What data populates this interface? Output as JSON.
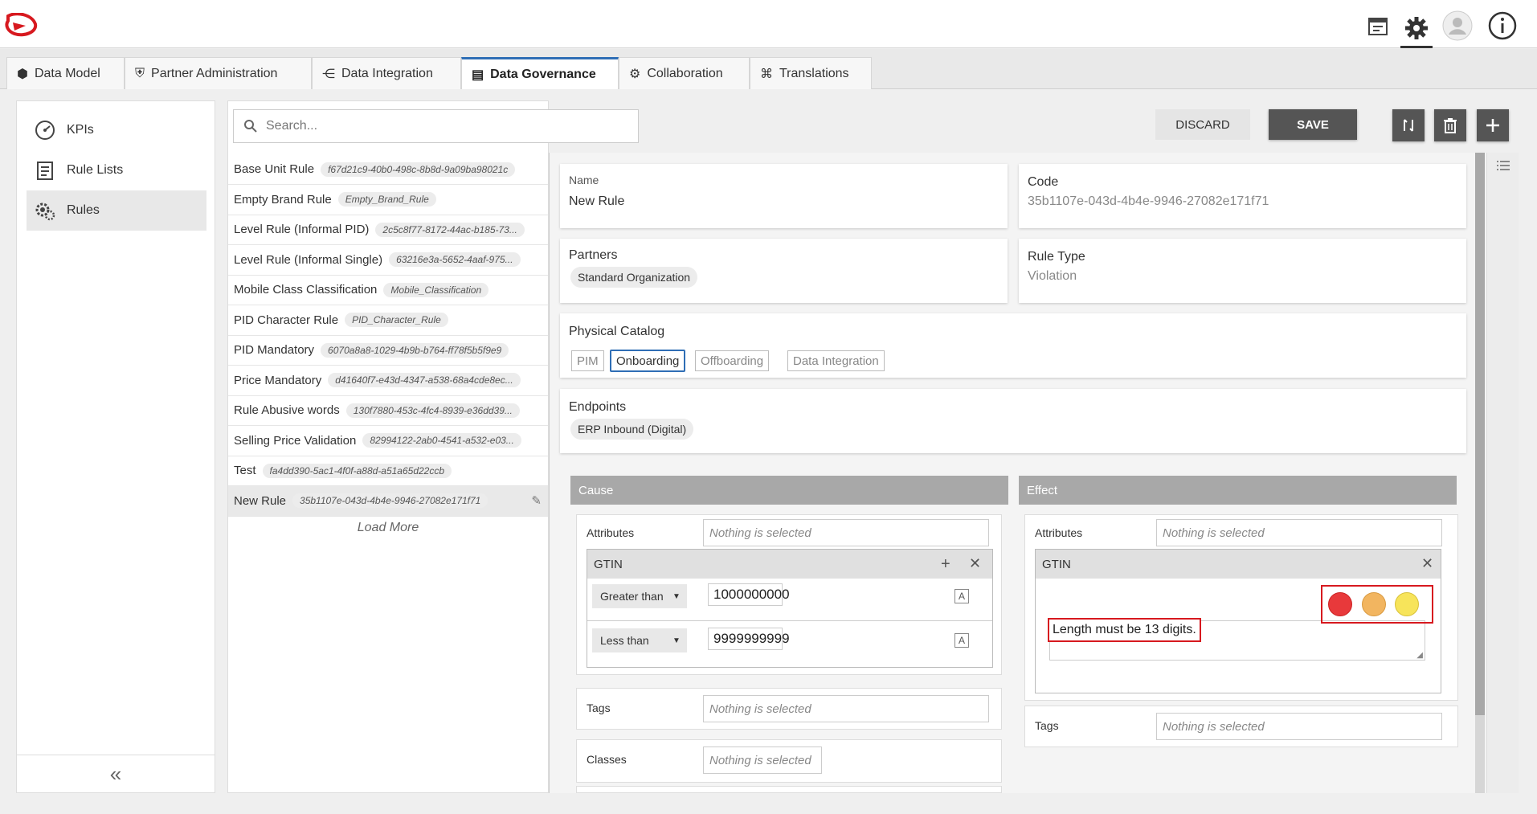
{
  "top_icons": [
    "calendar-icon",
    "gear-icon",
    "user-avatar-icon",
    "info-icon"
  ],
  "tabs": [
    {
      "label": "Data Model",
      "icon": "cubes-icon"
    },
    {
      "label": "Partner Administration",
      "icon": "shield-icon"
    },
    {
      "label": "Data Integration",
      "icon": "share-nodes-icon"
    },
    {
      "label": "Data Governance",
      "icon": "document-check-icon"
    },
    {
      "label": "Collaboration",
      "icon": "gears-icon"
    },
    {
      "label": "Translations",
      "icon": "translate-icon"
    }
  ],
  "active_tab": "Data Governance",
  "nav": {
    "items": [
      {
        "label": "KPIs",
        "icon": "gauge-icon"
      },
      {
        "label": "Rule Lists",
        "icon": "checklist-icon"
      },
      {
        "label": "Rules",
        "icon": "rules-gear-icon"
      }
    ],
    "active": "Rules",
    "collapse_glyph": "«"
  },
  "search": {
    "placeholder": "Search..."
  },
  "toolbar": {
    "discard_label": "DISCARD",
    "save_label": "SAVE"
  },
  "rules": [
    {
      "name": "Base Unit Rule",
      "code": "f67d21c9-40b0-498c-8b8d-9a09ba98021c"
    },
    {
      "name": "Empty Brand Rule",
      "code": "Empty_Brand_Rule"
    },
    {
      "name": "Level Rule (Informal PID)",
      "code": "2c5c8f77-8172-44ac-b185-73..."
    },
    {
      "name": "Level Rule (Informal Single)",
      "code": "63216e3a-5652-4aaf-975..."
    },
    {
      "name": "Mobile Class Classification",
      "code": "Mobile_Classification"
    },
    {
      "name": "PID Character Rule",
      "code": "PID_Character_Rule"
    },
    {
      "name": "PID Mandatory",
      "code": "6070a8a8-1029-4b9b-b764-ff78f5b5f9e9"
    },
    {
      "name": "Price Mandatory",
      "code": "d41640f7-e43d-4347-a538-68a4cde8ec..."
    },
    {
      "name": "Rule Abusive words",
      "code": "130f7880-453c-4fc4-8939-e36dd39..."
    },
    {
      "name": "Selling Price Validation",
      "code": "82994122-2ab0-4541-a532-e03..."
    },
    {
      "name": "Test",
      "code": "fa4dd390-5ac1-4f0f-a88d-a51a65d22ccb"
    },
    {
      "name": "New Rule",
      "code": "35b1107e-043d-4b4e-9946-27082e171f71"
    }
  ],
  "selected_rule_index": 11,
  "load_more": "Load More",
  "detail": {
    "name_label": "Name",
    "name_value": "New Rule",
    "code_label": "Code",
    "code_value": "35b1107e-043d-4b4e-9946-27082e171f71",
    "partners_label": "Partners",
    "partners_chip": "Standard Organization",
    "ruletype_label": "Rule Type",
    "ruletype_value": "Violation",
    "catalog_label": "Physical Catalog",
    "catalogs": [
      "PIM",
      "Onboarding",
      "Offboarding",
      "Data Integration"
    ],
    "catalog_selected": "Onboarding",
    "endpoints_label": "Endpoints",
    "endpoints_chip": "ERP Inbound (Digital)"
  },
  "cause": {
    "title": "Cause",
    "attributes_label": "Attributes",
    "attributes_placeholder": "Nothing is selected",
    "gtin_title": "GTIN",
    "conditions": [
      {
        "operator": "Greater than",
        "value": "1000000000"
      },
      {
        "operator": "Less than",
        "value": "9999999999"
      }
    ],
    "tags_label": "Tags",
    "tags_placeholder": "Nothing is selected",
    "classes_label": "Classes",
    "classes_placeholder": "Nothing is selected"
  },
  "effect": {
    "title": "Effect",
    "attributes_label": "Attributes",
    "attributes_placeholder": "Nothing is selected",
    "gtin_title": "GTIN",
    "severity_colors": [
      "#e8393b",
      "#f2b560",
      "#f7e45a"
    ],
    "message": "Length must be 13 digits.",
    "tags_label": "Tags",
    "tags_placeholder": "Nothing is selected"
  },
  "colors": {
    "accent": "#2f6eb5",
    "save_button": "#555555",
    "highlight": "#d7191f"
  }
}
